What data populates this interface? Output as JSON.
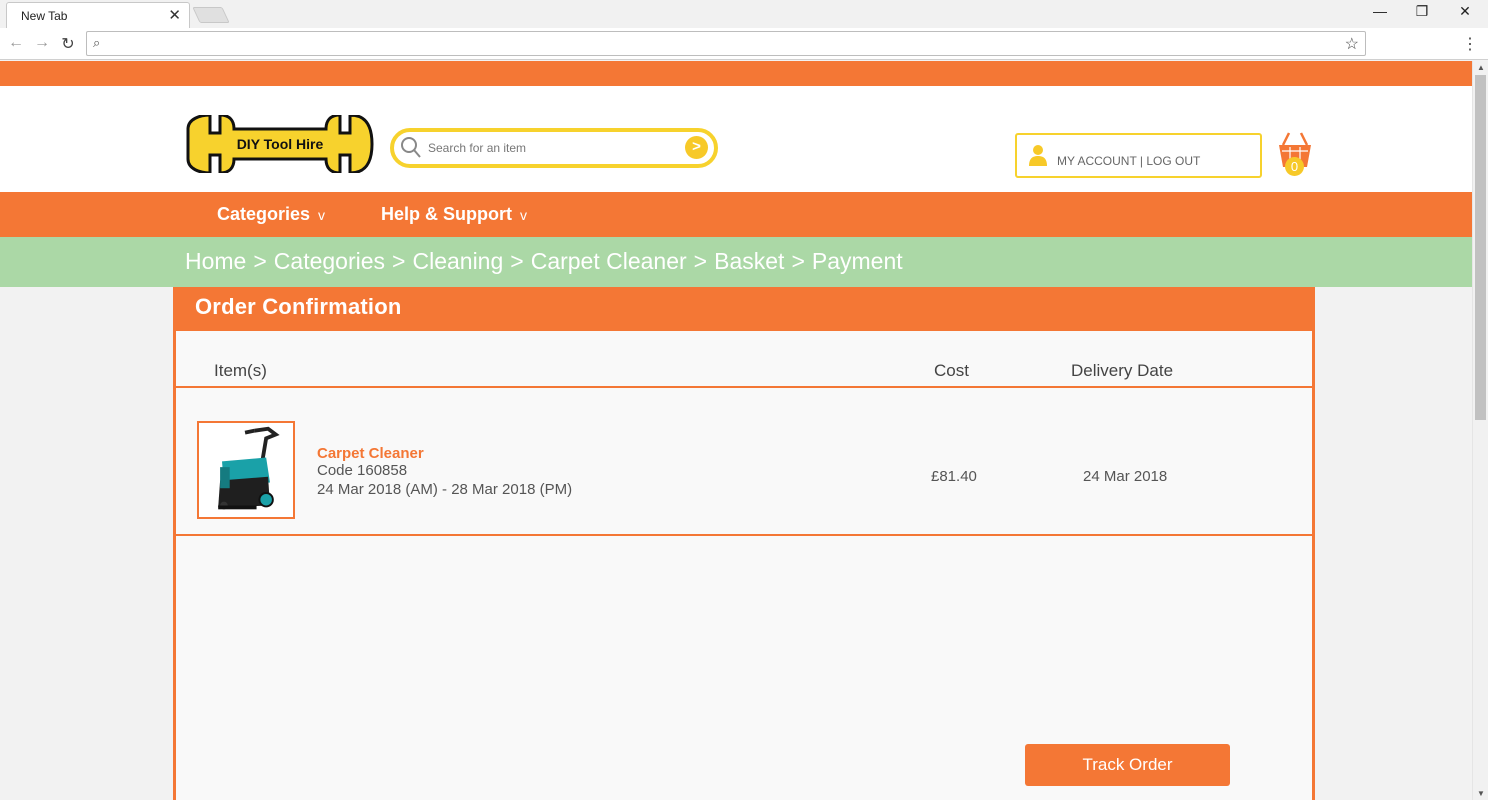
{
  "browser": {
    "tab_title": "New Tab",
    "tab_close": "✕",
    "win_minimize": "—",
    "win_restore": "❐",
    "win_close": "✕",
    "nav_back": "←",
    "nav_forward": "→",
    "nav_reload": "↻",
    "omnibox_value": "",
    "search_glyph": "⌕",
    "star_glyph": "☆",
    "menu_glyph": "⋮"
  },
  "site": {
    "logo_text": "DIY Tool Hire",
    "search": {
      "placeholder": "Search for an item",
      "go_glyph": ">"
    },
    "account_text": "MY ACCOUNT | LOG OUT",
    "basket_count": "0",
    "nav": [
      {
        "label": "Categories",
        "chevron": "v"
      },
      {
        "label": "Help & Support",
        "chevron": "v"
      }
    ],
    "breadcrumb": [
      "Home",
      "Categories",
      "Cleaning",
      "Carpet Cleaner",
      "Basket",
      "Payment"
    ],
    "breadcrumb_separator": ">",
    "colors": {
      "brand_orange": "#f47735",
      "accent_yellow": "#f7d22d",
      "breadcrumb_green": "#abd8a6"
    }
  },
  "order": {
    "title": "Order Confirmation",
    "columns": {
      "items": "Item(s)",
      "cost": "Cost",
      "delivery": "Delivery Date"
    },
    "items": [
      {
        "name": "Carpet Cleaner",
        "code": "Code 160858",
        "hire_dates": "24 Mar 2018 (AM) - 28 Mar 2018 (PM)",
        "cost": "£81.40",
        "delivery_date": "24 Mar 2018"
      }
    ],
    "track_label": "Track Order"
  }
}
